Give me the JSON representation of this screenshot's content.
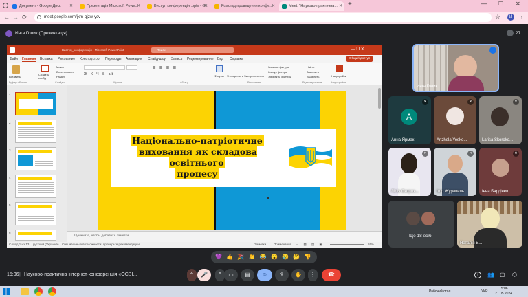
{
  "browser": {
    "tabs": [
      {
        "label": "Документ - Google Диск",
        "color": "#1a73e8"
      },
      {
        "label": "Презентація Microsoft Powe...",
        "color": "#fbbc04"
      },
      {
        "label": "Виступ конференція .pptx - G...",
        "color": "#fbbc04"
      },
      {
        "label": "Розклад проведення конфе...",
        "color": "#f4b400"
      },
      {
        "label": "Meet: \"Науково-практична ...",
        "color": "#00897b"
      }
    ],
    "new_tab": "+",
    "url": "meet.google.com/jxm-qjzw-ycv",
    "profile_letter": "И"
  },
  "meet": {
    "presenter_label": "Инга Голик (Презентація)",
    "participant_count": "27",
    "time": "15:06",
    "meeting_title": "Науково-практична інтернет-конференція «ОСВІ...",
    "reactions": [
      "💜",
      "👍",
      "🎉",
      "👏",
      "😂",
      "😮",
      "😢",
      "🤔",
      "👎"
    ]
  },
  "powerpoint": {
    "title": "Виступ_конференція - Microsoft PowerPoint",
    "search_placeholder": "Поиск",
    "share_button": "Общий доступ",
    "ribbon_tabs": [
      "Файл",
      "Главная",
      "Вставка",
      "Рисование",
      "Конструктор",
      "Переходы",
      "Анимация",
      "Слайд-шоу",
      "Запись",
      "Рецензирование",
      "Вид",
      "Справка"
    ],
    "groups": [
      "Буфер обмена",
      "Слайды",
      "Шрифт",
      "Абзац",
      "Рисование",
      "Редактирование",
      "Надстройки"
    ],
    "buttons": {
      "paste": "Вставить",
      "new_slide": "Создать слайд",
      "layout": "Макет",
      "reset": "Восстановить",
      "sections": "Раздел",
      "shapes": "Фигуры",
      "arrange": "Упорядочить",
      "quick_styles": "Экспресс-стили",
      "fill": "Заливка фигуры",
      "outline": "Контур фигуры",
      "effects": "Эффекты фигуры",
      "find": "Найти",
      "replace": "Заменить",
      "select": "Выделить",
      "addins": "Надстройки"
    },
    "slide_numbers": [
      "1",
      "2",
      "3",
      "4",
      "5",
      "6"
    ],
    "notes_placeholder": "Щелкните, чтобы добавить заметки",
    "status": {
      "slide_info": "Слайд 1 из 13",
      "language": "русский (Украина)",
      "accessibility": "Специальные возможности: проверьте рекомендации",
      "notes": "Заметки",
      "comments": "Примечания",
      "zoom": "65%"
    }
  },
  "slide": {
    "title_line1": "Національно-патріотичне",
    "title_line2": "виховання як складова освітнього",
    "title_line3": "процесу"
  },
  "participants": [
    {
      "name": "Инга Голик"
    },
    {
      "name": "Анна Ярмак",
      "initial": "A"
    },
    {
      "name": "Anzhela Yesko..."
    },
    {
      "name": "Larisa Skoroko..."
    },
    {
      "name": "Лілія Скорох..."
    },
    {
      "name": "Ігор Журавель"
    },
    {
      "name": "Інна Бардічев..."
    },
    {
      "name": "Ще 18 осіб"
    },
    {
      "name": "Наталія В..."
    }
  ],
  "taskbar": {
    "desktop_label": "Рабочий стол",
    "lang": "УКР",
    "clock_time": "15:06",
    "clock_date": "21.05.2024"
  },
  "colors": {
    "yellow": "#fcd303",
    "blue": "#0f98d6",
    "meet_bg": "#202124",
    "end_call": "#ea4335",
    "ppt_red": "#c5391a"
  }
}
